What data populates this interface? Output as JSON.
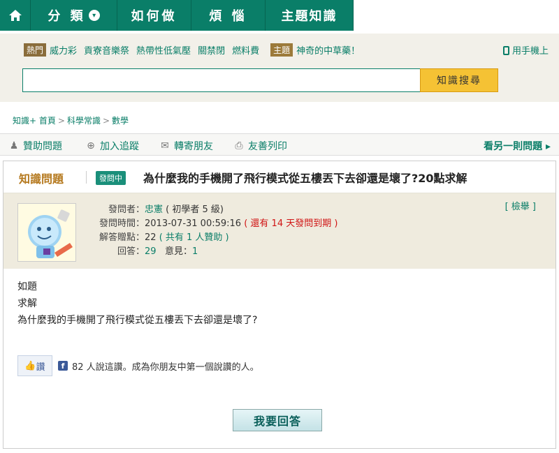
{
  "nav": {
    "category": "分 類",
    "how_to": "如何做",
    "worry": "煩 惱",
    "topic": "主題知識"
  },
  "search": {
    "hot_tag": "熱門",
    "hot_items": [
      "威力彩",
      "貢寮音樂祭",
      "熱帶性低氣壓",
      "關禁閉",
      "燃料費"
    ],
    "topic_tag": "主題",
    "topic_item": "神奇的中草藥！",
    "mobile_link": "用手機上",
    "input_value": "",
    "button_label": "知識搜尋"
  },
  "breadcrumb": [
    "知識+ 首頁",
    "科學常識",
    "數學"
  ],
  "actions": {
    "sponsor": "贊助問題",
    "follow": "加入追蹤",
    "forward": "轉寄朋友",
    "print": "友善列印",
    "next": "看另一則問題 ▸"
  },
  "question": {
    "section_label": "知識問題",
    "status": "發問中",
    "title": "為什麼我的手機開了飛行模式從五樓丟下去卻還是壞了?20點求解",
    "report": "[ 檢舉 ]",
    "asker_label": "發問者：",
    "asker_name": "忠憲",
    "asker_level": "( 初學者 5 級)",
    "time_label": "發問時間：",
    "time_value": "2013-07-31 00:59:16",
    "time_remaining": "( 還有 14 天發問到期 )",
    "points_label": "解答贈點：",
    "points_value": "22",
    "points_note": "( 共有 1 人贊助 )",
    "answers_label": "回答：",
    "answers_count": "29",
    "opinions_label": "意見：",
    "opinions_count": "1",
    "body": [
      "如題",
      "求解",
      "為什麼我的手機開了飛行模式從五樓丟下去卻還是壞了?"
    ],
    "like_label": "讚",
    "like_text": "82 人說這讚。成為你朋友中第一個說讚的人。",
    "answer_button": "我要回答"
  },
  "colors": {
    "brand_green": "#0a7e68",
    "search_button": "#f5c234",
    "section_label": "#b5791e",
    "remaining_red": "#d01414"
  }
}
